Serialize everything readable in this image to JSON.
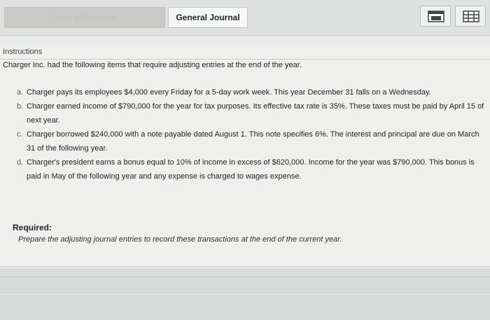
{
  "tabs": {
    "chart_of_accounts": "Chart of Accounts",
    "general_journal": "General Journal"
  },
  "toolbar": {
    "icon1": "calendar-icon",
    "icon2": "grid-icon"
  },
  "instructions": {
    "heading": "Instructions",
    "intro": "Charger Inc. had the following items that require adjusting entries at the end of the year.",
    "items": [
      {
        "letter": "a.",
        "text": "Charger pays its employees $4,000 every Friday for a 5-day work week. This year December 31 falls on a Wednesday."
      },
      {
        "letter": "b.",
        "text": "Charger earned income of $790,000 for the year for tax purposes. Its effective tax rate is 35%. These taxes must be paid by April 15 of next year."
      },
      {
        "letter": "c.",
        "text": "Charger borrowed $240,000 with a note payable dated August 1. This note specifies 6%. The interest and principal are due on March 31 of the following year."
      },
      {
        "letter": "d.",
        "text": "Charger's president earns a bonus equal to 10% of income in excess of $620,000. Income for the year was $790,000. This bonus is paid in May of the following year and any expense is charged to wages expense."
      }
    ],
    "required_label": "Required:",
    "required_text": "Prepare the adjusting journal entries to record these transactions at the end of the current year."
  }
}
